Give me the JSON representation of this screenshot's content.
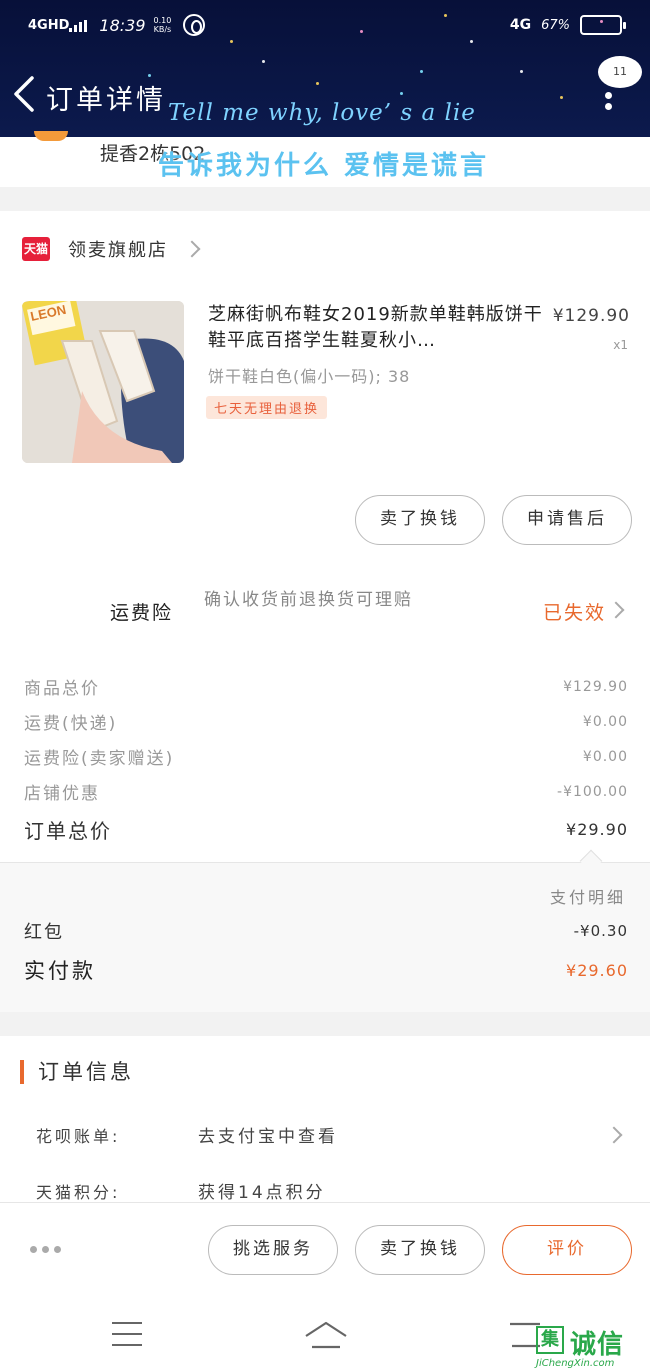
{
  "status_bar": {
    "signal": "4GHD",
    "time": "18:39",
    "speed_value": "0.10",
    "speed_unit": "KB/s",
    "network": "4G",
    "battery_percent": "67%",
    "battery_level": 0.67
  },
  "header": {
    "title": "订单详情",
    "lyric_en": "Tell me why, love’ s a lie",
    "lyric_zh": "告诉我为什么 爱情是谎言",
    "more_badge": "11"
  },
  "address": {
    "text": "提香2栋502"
  },
  "store": {
    "badge": "天猫",
    "name": "领麦旗舰店"
  },
  "product": {
    "title": "芝麻街帆布鞋女2019新款单鞋韩版饼干鞋平底百搭学生鞋夏秋小…",
    "price": "¥129.90",
    "quantity": "x1",
    "sku": "饼干鞋白色(偏小一码); 38",
    "tag": "七天无理由退换"
  },
  "item_actions": {
    "resell": "卖了换钱",
    "after_sale": "申请售后"
  },
  "insurance": {
    "label": "运费险",
    "description": "确认收货前退换货可理赔",
    "status": "已失效"
  },
  "fees": [
    {
      "label": "商品总价",
      "value": "¥129.90"
    },
    {
      "label": "运费(快递)",
      "value": "¥0.00"
    },
    {
      "label": "运费险(卖家赠送)",
      "value": "¥0.00"
    },
    {
      "label": "店铺优惠",
      "value": "-¥100.00"
    }
  ],
  "order_total": {
    "label": "订单总价",
    "value": "¥29.90"
  },
  "payment": {
    "detail_link": "支付明细",
    "red_packet_label": "红包",
    "red_packet_value": "-¥0.30",
    "paid_label": "实付款",
    "paid_value": "¥29.60"
  },
  "order_info": {
    "title": "订单信息",
    "rows": [
      {
        "key": "花呗账单:",
        "value": "去支付宝中查看"
      },
      {
        "key": "天猫积分:",
        "value": "获得14点积分"
      }
    ]
  },
  "bottom_actions": {
    "service": "挑选服务",
    "resell": "卖了换钱",
    "review": "评价"
  },
  "watermark": {
    "mark": "集",
    "brand": "诚信",
    "url": "JiChengXin.com"
  },
  "colors": {
    "accent": "#e8692e",
    "tmall_red": "#e6203a",
    "header_bg": "#0c1a4d"
  }
}
